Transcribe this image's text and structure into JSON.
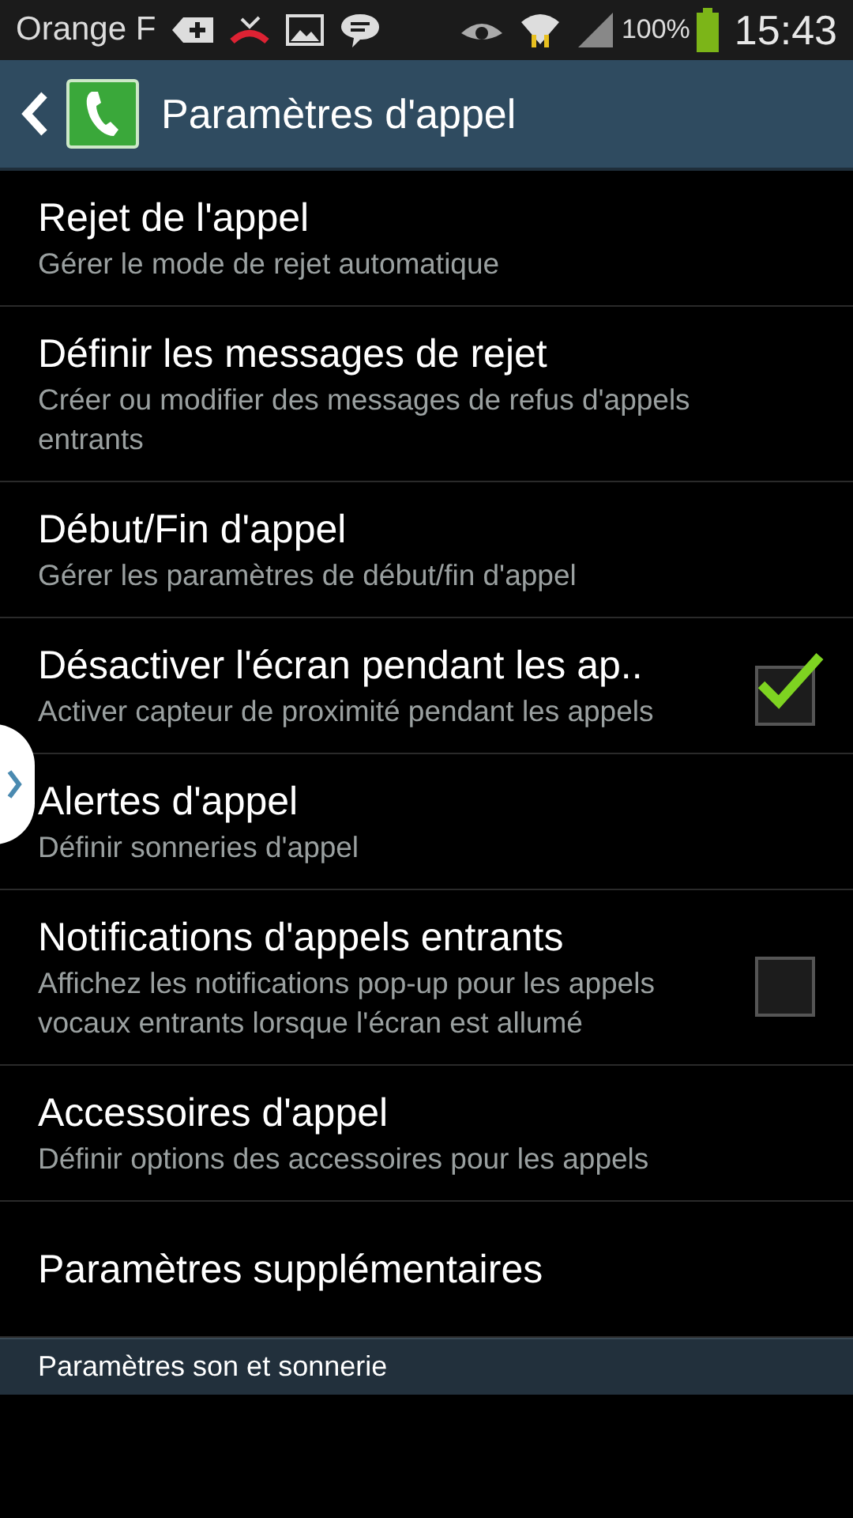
{
  "status_bar": {
    "carrier": "Orange F",
    "battery": "100%",
    "time": "15:43"
  },
  "header": {
    "title": "Paramètres d'appel"
  },
  "items": [
    {
      "kind": "plain",
      "title": "Rejet de l'appel",
      "subtitle": "Gérer le mode de rejet automatique"
    },
    {
      "kind": "plain",
      "title": "Définir les messages de rejet",
      "subtitle": "Créer ou modifier des messages de refus d'appels entrants"
    },
    {
      "kind": "plain",
      "title": "Début/Fin d'appel",
      "subtitle": "Gérer les paramètres de début/fin d'appel"
    },
    {
      "kind": "checkbox",
      "title": "Désactiver l'écran pendant les ap..",
      "subtitle": "Activer capteur de proximité pendant les appels",
      "checked": true
    },
    {
      "kind": "plain",
      "title": "Alertes d'appel",
      "subtitle": "Définir sonneries d'appel"
    },
    {
      "kind": "checkbox",
      "title": "Notifications d'appels entrants",
      "subtitle": "Affichez les notifications pop-up pour les appels vocaux entrants lorsque l'écran est allumé",
      "checked": false
    },
    {
      "kind": "plain",
      "title": "Accessoires d'appel",
      "subtitle": "Définir options des accessoires pour les appels"
    },
    {
      "kind": "plain",
      "title": "Paramètres supplémentaires"
    }
  ],
  "section": {
    "title": "Paramètres son et sonnerie"
  }
}
